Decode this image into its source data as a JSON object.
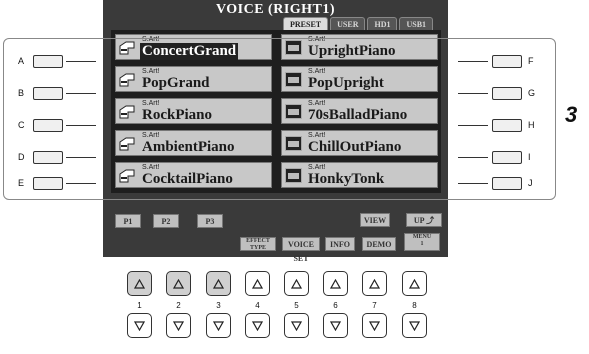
{
  "screen": {
    "title": "VOICE (RIGHT1)",
    "tabs": [
      "PRESET",
      "USER",
      "HD1",
      "USB1"
    ],
    "active_tab": 0,
    "voices_left": [
      {
        "tag": "S.Art!",
        "name": "ConcertGrand",
        "icon": "grand-piano-icon",
        "selected": true
      },
      {
        "tag": "S.Art!",
        "name": "PopGrand",
        "icon": "grand-piano-icon"
      },
      {
        "tag": "S.Art!",
        "name": "RockPiano",
        "icon": "grand-piano-icon"
      },
      {
        "tag": "S.Art!",
        "name": "AmbientPiano",
        "icon": "grand-piano-icon"
      },
      {
        "tag": "S.Art!",
        "name": "CocktailPiano",
        "icon": "grand-piano-icon"
      }
    ],
    "voices_right": [
      {
        "tag": "S.Art!",
        "name": "UprightPiano",
        "icon": "upright-piano-icon"
      },
      {
        "tag": "S.Art!",
        "name": "PopUpright",
        "icon": "upright-piano-icon"
      },
      {
        "tag": "S.Art!",
        "name": "70sBalladPiano",
        "icon": "upright-piano-icon"
      },
      {
        "tag": "S.Art!",
        "name": "ChillOutPiano",
        "icon": "upright-piano-icon"
      },
      {
        "tag": "S.Art!",
        "name": "HonkyTonk",
        "icon": "upright-piano-icon"
      }
    ],
    "page_buttons": [
      "P1",
      "P2",
      "P3"
    ],
    "view_label": "VIEW",
    "up_label": "UP",
    "function_labels": {
      "effect_type_1": "EFFECT",
      "effect_type_2": "TYPE",
      "voice_set": "VOICE SET",
      "info": "INFO",
      "demo": "DEMO",
      "menu_1": "MENU",
      "menu_2": "1"
    }
  },
  "side_left_letters": [
    "A",
    "B",
    "C",
    "D",
    "E"
  ],
  "side_right_letters": [
    "F",
    "G",
    "H",
    "I",
    "J"
  ],
  "callout_number": "3",
  "bottom_numbers": [
    "1",
    "2",
    "3",
    "4",
    "5",
    "6",
    "7",
    "8"
  ],
  "pressed_up_buttons": [
    1,
    2,
    3
  ],
  "colors": {
    "lcd_background": "#3a3a3a",
    "voice_cell": "#c8c8c8",
    "selected_text_bg": "#222222"
  }
}
